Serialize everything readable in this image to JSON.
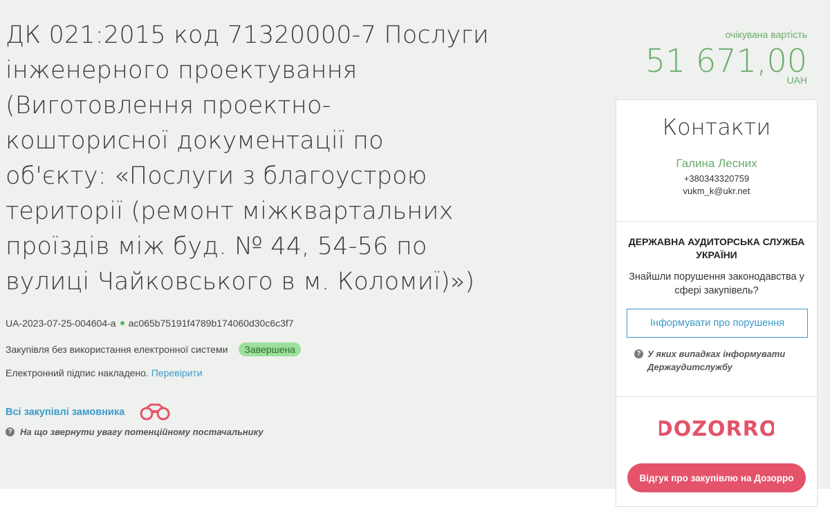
{
  "tender": {
    "title": "ДК 021:2015 код 71320000-7 Послуги інженерного проектування (Виготовлення проектно-кошторисної документації по об'єкту: «Послуги з благоустрою території (ремонт міжквартальних проїздів між буд. № 44, 54-56 по вулиці Чайковського в м. Коломиї)»)",
    "id": "UA-2023-07-25-004604-a",
    "hash": "ac065b75191f4789b174060d30c6c3f7",
    "procedure": "Закупівля без використання електронної системи",
    "status": "Завершена",
    "signature_text": "Електронний підпис накладено.",
    "signature_link": "Перевірити",
    "all_purchases_link": "Всі закупівлі замовника",
    "supplier_hint": "На що звернути увагу потенційному постачальнику"
  },
  "price": {
    "label": "очікувана вартість",
    "value": "51 671,00",
    "currency": "UAH"
  },
  "contacts": {
    "title": "Контакти",
    "name": "Галина Лесних",
    "phone": "+380343320759",
    "email": "vukm_k@ukr.net"
  },
  "audit": {
    "title": "ДЕРЖАВНА АУДИТОРСЬКА СЛУЖБА УКРАЇНИ",
    "text": "Знайшли порушення законодавства у сфері закупівель?",
    "button": "Інформувати про порушення",
    "hint": "У яких випадках інформувати Держаудитслужбу"
  },
  "dozorro": {
    "logo_text": "DOZORRO",
    "button": "Відгук про закупівлю на Дозорро"
  },
  "colors": {
    "accent_green": "#6aab6a",
    "link_blue": "#3a9ac9",
    "dozorro_red": "#e4536a",
    "status_badge_bg": "#9ce09c"
  }
}
